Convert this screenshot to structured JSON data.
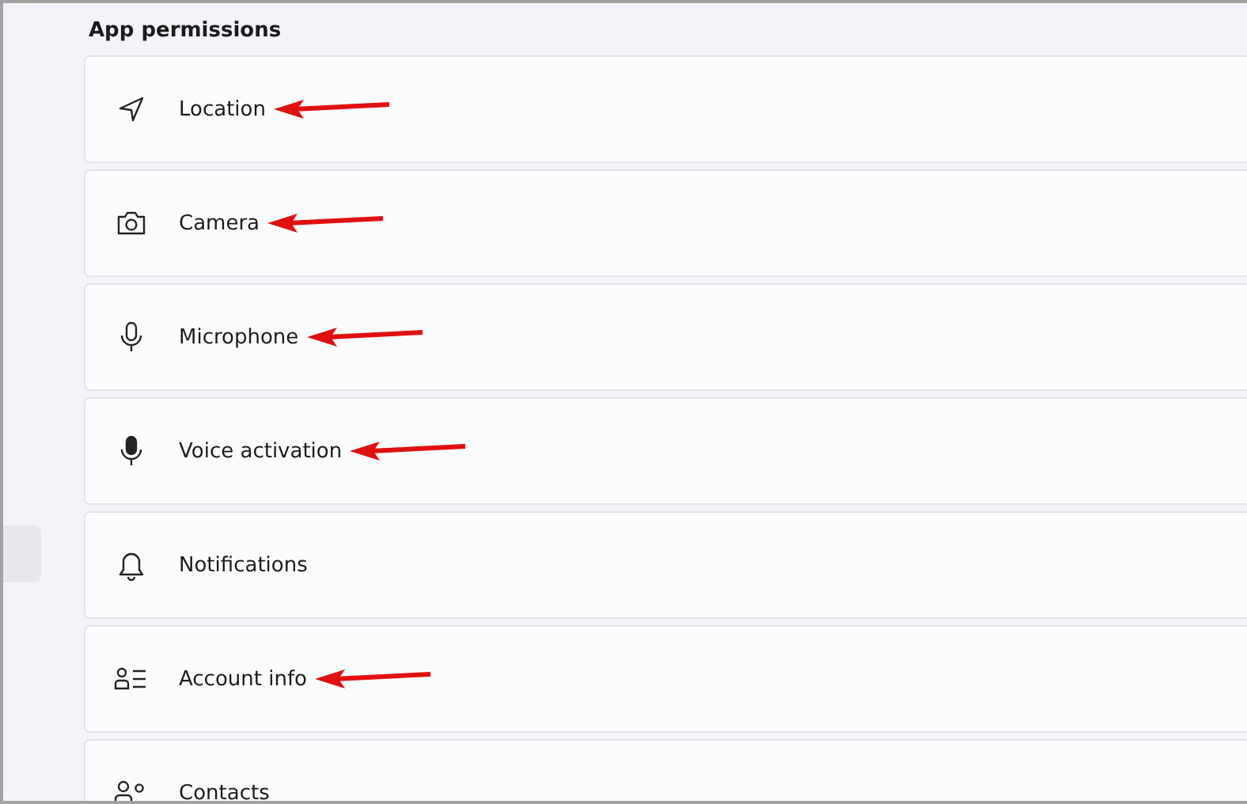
{
  "section": {
    "title": "App permissions"
  },
  "items": [
    {
      "label": "Location",
      "annotated": true
    },
    {
      "label": "Camera",
      "annotated": true
    },
    {
      "label": "Microphone",
      "annotated": true
    },
    {
      "label": "Voice activation",
      "annotated": true
    },
    {
      "label": "Notifications",
      "annotated": false
    },
    {
      "label": "Account info",
      "annotated": true
    },
    {
      "label": "Contacts",
      "annotated": false
    }
  ]
}
